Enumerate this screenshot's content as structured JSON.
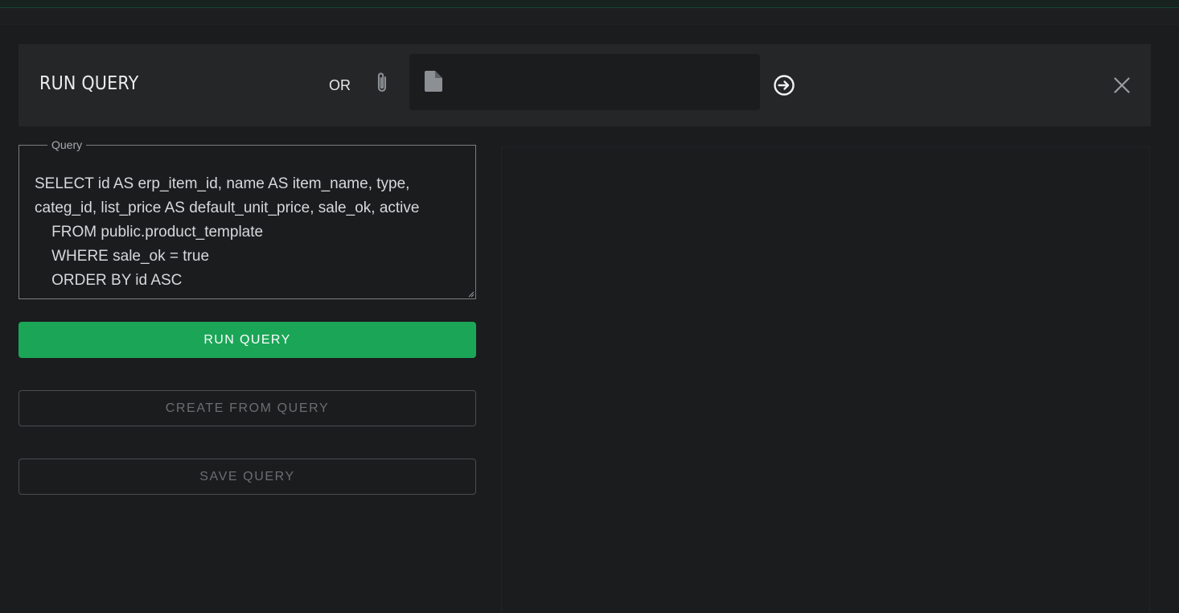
{
  "header": {
    "title": "RUN QUERY",
    "or_label": "OR",
    "icons": {
      "attach": "paperclip-icon",
      "file": "file-icon",
      "submit": "arrow-right-circle-icon",
      "close": "close-icon"
    }
  },
  "query": {
    "legend": "Query",
    "value": "SELECT id AS erp_item_id, name AS item_name, type, categ_id, list_price AS default_unit_price, sale_ok, active\n    FROM public.product_template\n    WHERE sale_ok = true\n    ORDER BY id ASC"
  },
  "actions": {
    "run_label": "RUN QUERY",
    "create_label": "CREATE FROM QUERY",
    "save_label": "SAVE QUERY"
  },
  "colors": {
    "background": "#1b1c1e",
    "panel": "#252628",
    "accent_green": "#1ba657",
    "muted_text": "#6b6d70"
  }
}
